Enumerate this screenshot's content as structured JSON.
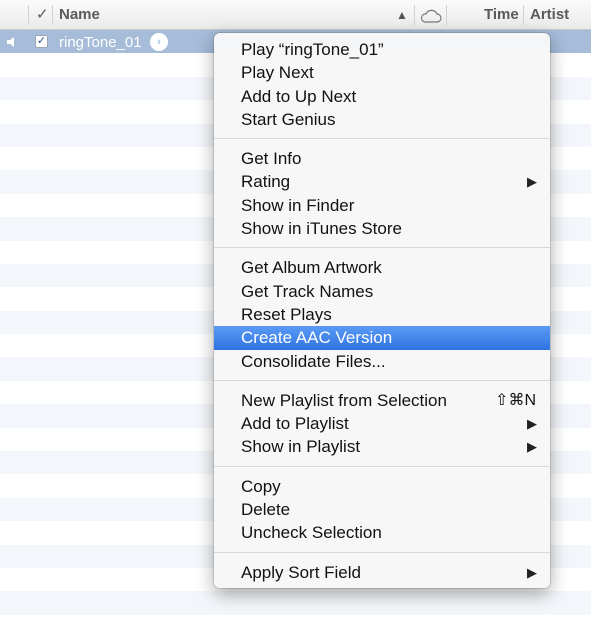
{
  "header": {
    "check_col": "✓",
    "name_col": "Name",
    "sort_indicator": "▲",
    "cloud_icon": "cloud-icon",
    "time_col": "Time",
    "artist_col": "Artist"
  },
  "selected_row": {
    "checked": "✓",
    "name": "ringTone_01",
    "speaker_icon": "speaker-icon",
    "go_arrow": "›"
  },
  "colors": {
    "selection": "#a6bcd9",
    "menu_highlight": "#3a82ea",
    "alt_row": "#f3f6fa"
  },
  "menu": {
    "groups": [
      [
        {
          "label": "Play “ringTone_01”"
        },
        {
          "label": "Play Next"
        },
        {
          "label": "Add to Up Next"
        },
        {
          "label": "Start Genius"
        }
      ],
      [
        {
          "label": "Get Info"
        },
        {
          "label": "Rating",
          "submenu": "▶"
        },
        {
          "label": "Show in Finder"
        },
        {
          "label": "Show in iTunes Store"
        }
      ],
      [
        {
          "label": "Get Album Artwork"
        },
        {
          "label": "Get Track Names"
        },
        {
          "label": "Reset Plays"
        },
        {
          "label": "Create AAC Version",
          "highlighted": true
        },
        {
          "label": "Consolidate Files..."
        }
      ],
      [
        {
          "label": "New Playlist from Selection",
          "shortcut": "⇧⌘N"
        },
        {
          "label": "Add to Playlist",
          "submenu": "▶"
        },
        {
          "label": "Show in Playlist",
          "submenu": "▶"
        }
      ],
      [
        {
          "label": "Copy"
        },
        {
          "label": "Delete"
        },
        {
          "label": "Uncheck Selection"
        }
      ],
      [
        {
          "label": "Apply Sort Field",
          "submenu": "▶"
        }
      ]
    ]
  }
}
